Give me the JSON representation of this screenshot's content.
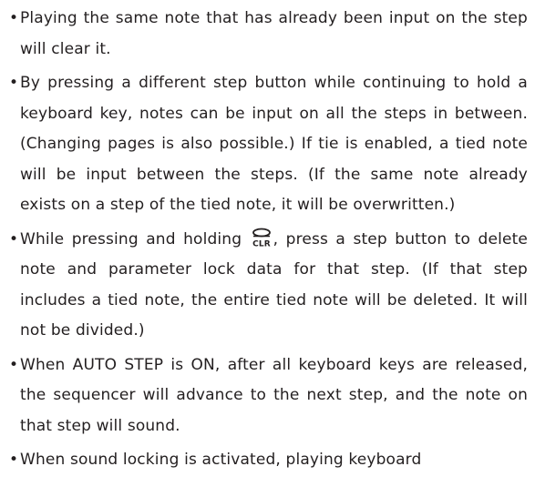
{
  "bullet_char": "•",
  "items": [
    {
      "text": "Playing the same note that has already been input on the step will clear it."
    },
    {
      "text": "By pressing a different step button while continuing to hold a keyboard key, notes can be input on all the steps in between. (Changing pages is also possible.) If tie is enabled, a tied note will be input between the steps. (If the same note already exists on a step of the tied note, it will be overwritten.)"
    },
    {
      "text_before": "While pressing and holding",
      "icon": "clr-button-icon",
      "icon_label": "CLR",
      "text_after": ", press a step button to delete note and parameter lock data for that step. (If that step includes a tied note, the entire tied note will be deleted. It will not be divided.)"
    },
    {
      "text": "When AUTO STEP is ON, after all keyboard keys are released, the sequencer will advance to the next step, and the note on that step will sound."
    },
    {
      "text": "When sound locking is activated, playing keyboard"
    }
  ]
}
